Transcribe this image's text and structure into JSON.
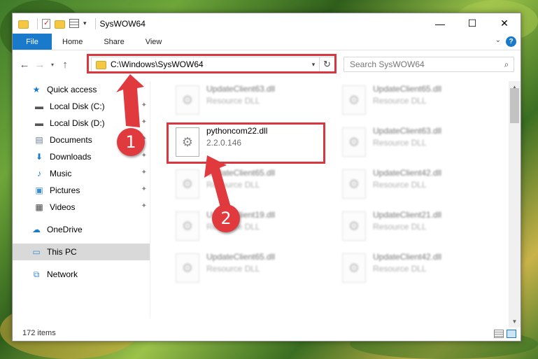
{
  "window": {
    "title": "SysWOW64",
    "controls": {
      "minimize": "—",
      "maximize": "☐",
      "close": "✕"
    }
  },
  "ribbon": {
    "tabs": [
      "File",
      "Home",
      "Share",
      "View"
    ],
    "help": "?"
  },
  "address": {
    "path": "C:\\Windows\\SysWOW64"
  },
  "search": {
    "placeholder": "Search SysWOW64"
  },
  "sidebar": {
    "quick_access": "Quick access",
    "items": [
      {
        "label": "Local Disk (C:)",
        "icon": "drive-icon"
      },
      {
        "label": "Local Disk (D:)",
        "icon": "drive-icon"
      },
      {
        "label": "Documents",
        "icon": "documents-icon"
      },
      {
        "label": "Downloads",
        "icon": "downloads-icon"
      },
      {
        "label": "Music",
        "icon": "music-icon"
      },
      {
        "label": "Pictures",
        "icon": "pictures-icon"
      },
      {
        "label": "Videos",
        "icon": "videos-icon"
      }
    ],
    "onedrive": "OneDrive",
    "this_pc": "This PC",
    "network": "Network"
  },
  "files": {
    "highlighted": {
      "name": "pythoncom22.dll",
      "version": "2.2.0.146"
    },
    "others": [
      {
        "name": "UpdateClient63.dll",
        "sub": "Resource DLL"
      },
      {
        "name": "UpdateClient65.dll",
        "sub": "Resource DLL"
      },
      {
        "name": "UpdateClient63.dll",
        "sub": "Resource DLL"
      },
      {
        "name": "UpdateClient65.dll",
        "sub": "Resource DLL"
      },
      {
        "name": "UpdateClient42.dll",
        "sub": "Resource DLL"
      },
      {
        "name": "UpdateClient19.dll",
        "sub": "Resource DLL"
      },
      {
        "name": "UpdateClient21.dll",
        "sub": "Resource DLL"
      },
      {
        "name": "UpdateClient65.dll",
        "sub": "Resource DLL"
      },
      {
        "name": "UpdateClient42.dll",
        "sub": "Resource DLL"
      }
    ]
  },
  "status": {
    "count": "172 items"
  },
  "annotations": {
    "badge1": "1",
    "badge2": "2",
    "color": "#e0393e"
  }
}
